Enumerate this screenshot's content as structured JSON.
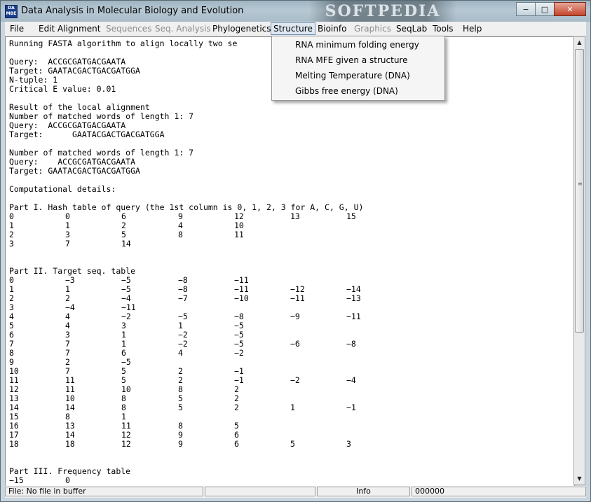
{
  "window": {
    "title": "Data Analysis in Molecular Biology and Evolution",
    "icon_text": "DA MBE",
    "watermark": "SOFTPEDIA",
    "buttons": {
      "minimize": "−",
      "maximize": "□",
      "close": "✕"
    }
  },
  "menu": [
    {
      "label": "File",
      "enabled": true
    },
    {
      "label": "Edit",
      "enabled": true
    },
    {
      "label": "Alignment",
      "enabled": true
    },
    {
      "label": "Sequences",
      "enabled": false
    },
    {
      "label": "Seq. Analysis",
      "enabled": false
    },
    {
      "label": "Phylogenetics",
      "enabled": true
    },
    {
      "label": "Structure",
      "enabled": true,
      "active": true
    },
    {
      "label": "Bioinfo",
      "enabled": true
    },
    {
      "label": "Graphics",
      "enabled": false
    },
    {
      "label": "SeqLab",
      "enabled": true
    },
    {
      "label": "Tools",
      "enabled": true
    },
    {
      "label": "Help",
      "enabled": true
    }
  ],
  "structure_menu": [
    "RNA minimum folding energy",
    "RNA MFE given a structure",
    "Melting Temperature (DNA)",
    "Gibbs free energy (DNA)"
  ],
  "content": {
    "header_lines": [
      "Running FASTA algorithm to align locally two se",
      "",
      "Query:  ACCGCGATGACGAATA",
      "Target: GAATACGACTGACGATGGA",
      "N-tuple: 1",
      "Critical E value: 0.01",
      "",
      "Result of the local alignment",
      "Number of matched words of length 1: 7",
      "Query:  ACCGCGATGACGAATA",
      "Target:      GAATACGACTGACGATGGA",
      "",
      "Number of matched words of length 1: 7",
      "Query:    ACCGCGATGACGAATA",
      "Target: GAATACGACTGACGATGGA",
      "",
      "Computational details:",
      "",
      "Part I. Hash table of query (the 1st column is 0, 1, 2, 3 for A, C, G, U)"
    ],
    "hash_table": [
      [
        "0",
        "0",
        "6",
        "9",
        "12",
        "13",
        "15"
      ],
      [
        "1",
        "1",
        "2",
        "4",
        "10",
        "",
        ""
      ],
      [
        "2",
        "3",
        "5",
        "8",
        "11",
        "",
        ""
      ],
      [
        "3",
        "7",
        "14",
        "",
        "",
        "",
        ""
      ]
    ],
    "part2_title": "Part II. Target seq. table",
    "target_table": [
      [
        "0",
        "−3",
        "−5",
        "−8",
        "−11",
        "",
        ""
      ],
      [
        "1",
        "1",
        "−5",
        "−8",
        "−11",
        "−12",
        "−14"
      ],
      [
        "2",
        "2",
        "−4",
        "−7",
        "−10",
        "−11",
        "−13"
      ],
      [
        "3",
        "−4",
        "−11",
        "",
        "",
        "",
        ""
      ],
      [
        "4",
        "4",
        "−2",
        "−5",
        "−8",
        "−9",
        "−11"
      ],
      [
        "5",
        "4",
        "3",
        "1",
        "−5",
        "",
        ""
      ],
      [
        "6",
        "3",
        "1",
        "−2",
        "−5",
        "",
        ""
      ],
      [
        "7",
        "7",
        "1",
        "−2",
        "−5",
        "−6",
        "−8"
      ],
      [
        "8",
        "7",
        "6",
        "4",
        "−2",
        "",
        ""
      ],
      [
        "9",
        "2",
        "−5",
        "",
        "",
        "",
        ""
      ],
      [
        "10",
        "7",
        "5",
        "2",
        "−1",
        "",
        ""
      ],
      [
        "11",
        "11",
        "5",
        "2",
        "−1",
        "−2",
        "−4"
      ],
      [
        "12",
        "11",
        "10",
        "8",
        "2",
        "",
        ""
      ],
      [
        "13",
        "10",
        "8",
        "5",
        "2",
        "",
        ""
      ],
      [
        "14",
        "14",
        "8",
        "5",
        "2",
        "1",
        "−1"
      ],
      [
        "15",
        "8",
        "1",
        "",
        "",
        "",
        ""
      ],
      [
        "16",
        "13",
        "11",
        "8",
        "5",
        "",
        ""
      ],
      [
        "17",
        "14",
        "12",
        "9",
        "6",
        "",
        ""
      ],
      [
        "18",
        "18",
        "12",
        "9",
        "6",
        "5",
        "3"
      ]
    ],
    "part3_title": "Part III. Frequency table",
    "part3_first_row": [
      "−15",
      "0"
    ]
  },
  "status": {
    "file": "File: No file in buffer",
    "panel2": "",
    "info": "Info",
    "counter": "000000"
  }
}
